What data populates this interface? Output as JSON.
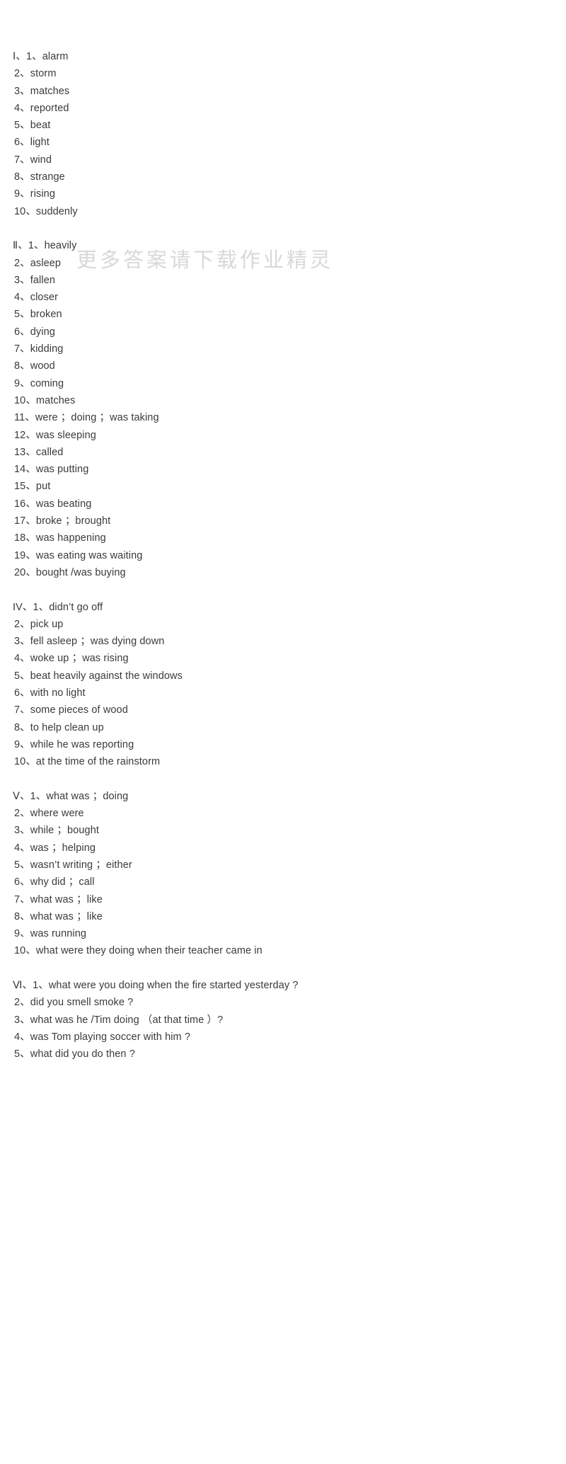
{
  "page": {
    "background_color": "#ffffff",
    "text_color": "#3a3a3a"
  },
  "watermark": {
    "text": "更多答案请下载作业精灵",
    "color": "#d8d8d8"
  },
  "sections": [
    {
      "label": "Ⅰ",
      "lines": [
        "Ⅰ、1、alarm",
        "2、storm",
        "3、matches",
        "4、reported",
        "5、beat",
        "6、light",
        "7、wind",
        "8、strange",
        "9、rising",
        "10、suddenly"
      ]
    },
    {
      "label": "Ⅱ",
      "lines": [
        "Ⅱ、1、heavily",
        "2、asleep",
        "3、fallen",
        "4、closer",
        "5、broken",
        "6、dying",
        "7、kidding",
        "8、wood",
        "9、coming",
        "10、matches",
        "11、were ；doing ；was taking",
        "12、was sleeping",
        "13、called",
        "14、was putting",
        "15、put",
        "16、was beating",
        "17、broke ；brought",
        "18、was happening",
        "19、was eating was waiting",
        "20、bought /was buying"
      ]
    },
    {
      "label": "IV",
      "lines": [
        "IV、1、didn’t go off",
        "2、pick up",
        "3、fell asleep ；was dying down",
        "4、woke up ；was rising",
        "5、beat heavily against the windows",
        "6、with no light",
        "7、some pieces of wood",
        "8、to help clean up",
        "9、while he was reporting",
        "10、at the time of the rainstorm"
      ]
    },
    {
      "label": "Ⅴ",
      "lines": [
        "Ⅴ、1、what was ；doing",
        "2、where were",
        "3、while ；bought",
        "4、was ；helping",
        "5、wasn’t writing ；either",
        "6、why did ；call",
        "7、what was ；like",
        "8、what was ；like",
        "9、was running",
        "10、what were they doing when their teacher came in"
      ]
    },
    {
      "label": "Ⅵ",
      "lines": [
        "Ⅵ、1、what were you doing when the fire started yesterday ?",
        "2、did you smell smoke ?",
        "3、what was he /Tim doing （at that time ）?",
        "4、was Tom playing soccer with him ?",
        "5、what did you do then ?"
      ]
    }
  ]
}
